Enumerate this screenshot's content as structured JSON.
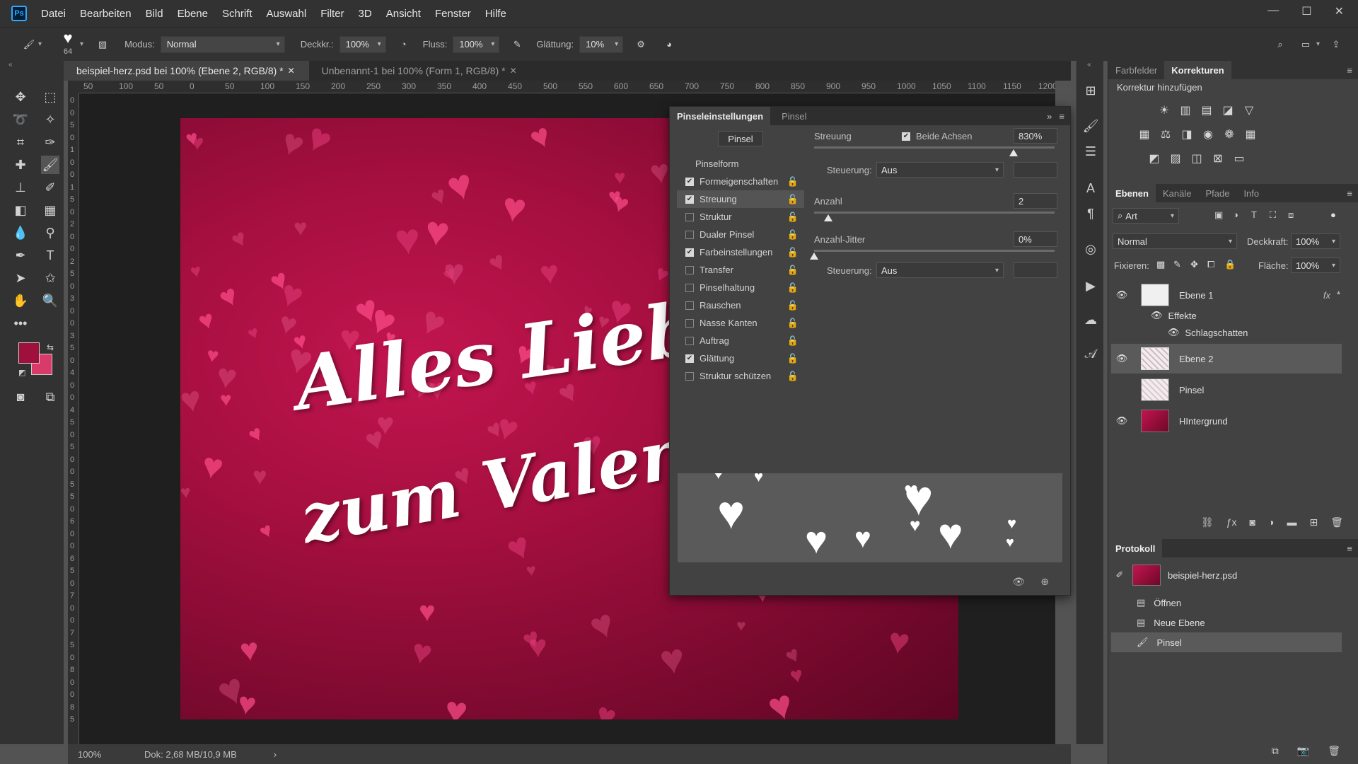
{
  "app": {
    "logo": "Ps"
  },
  "menu": [
    "Datei",
    "Bearbeiten",
    "Bild",
    "Ebene",
    "Schrift",
    "Auswahl",
    "Filter",
    "3D",
    "Ansicht",
    "Fenster",
    "Hilfe"
  ],
  "options": {
    "brush_size": "64",
    "modus_label": "Modus:",
    "modus_value": "Normal",
    "deckkraft_label": "Deckkr.:",
    "deckkraft_value": "100%",
    "fluss_label": "Fluss:",
    "fluss_value": "100%",
    "glaettung_label": "Glättung:",
    "glaettung_value": "10%"
  },
  "doc_tabs": [
    {
      "label": "beispiel-herz.psd bei 100% (Ebene 2, RGB/8) *",
      "active": true
    },
    {
      "label": "Unbenannt-1 bei 100% (Form 1, RGB/8) *",
      "active": false
    }
  ],
  "ruler_top": [
    "50",
    "100",
    "50",
    "0",
    "50",
    "100",
    "150",
    "200",
    "250",
    "300",
    "350",
    "400",
    "450",
    "500",
    "550",
    "600",
    "650",
    "700",
    "750",
    "800",
    "850",
    "900",
    "950",
    "1000",
    "1050",
    "1100",
    "1150",
    "1200"
  ],
  "ruler_left": [
    "0",
    "0",
    "5",
    "0",
    "1",
    "0",
    "0",
    "1",
    "5",
    "0",
    "2",
    "0",
    "0",
    "2",
    "5",
    "0",
    "3",
    "0",
    "0",
    "3",
    "5",
    "0",
    "4",
    "0",
    "0",
    "4",
    "5",
    "0",
    "5",
    "0",
    "0",
    "5",
    "5",
    "0",
    "6",
    "0",
    "0",
    "6",
    "5",
    "0",
    "7",
    "0",
    "0",
    "7",
    "5",
    "0",
    "8",
    "0",
    "0",
    "8",
    "5"
  ],
  "canvas_text": {
    "line1": "Alles Liebe",
    "line2": "zum Valentinstag"
  },
  "colors": {
    "foreground": "#a0103d",
    "background": "#d83a6a",
    "accent": "#31a8ff"
  },
  "status": {
    "zoom": "100%",
    "doc": "Dok: 2,68 MB/10,9 MB"
  },
  "brush_panel": {
    "tab_active": "Pinseleinstellungen",
    "tab_other": "Pinsel",
    "pinsel_button": "Pinsel",
    "pinselform": "Pinselform",
    "items": [
      {
        "label": "Formeigenschaften",
        "checked": true
      },
      {
        "label": "Streuung",
        "checked": true,
        "selected": true
      },
      {
        "label": "Struktur",
        "checked": false
      },
      {
        "label": "Dualer Pinsel",
        "checked": false
      },
      {
        "label": "Farbeinstellungen",
        "checked": true
      },
      {
        "label": "Transfer",
        "checked": false
      },
      {
        "label": "Pinselhaltung",
        "checked": false
      },
      {
        "label": "Rauschen",
        "checked": false
      },
      {
        "label": "Nasse Kanten",
        "checked": false
      },
      {
        "label": "Auftrag",
        "checked": false
      },
      {
        "label": "Glättung",
        "checked": true
      },
      {
        "label": "Struktur schützen",
        "checked": false
      }
    ],
    "streuung_label": "Streuung",
    "beide_achsen": "Beide Achsen",
    "streuung_value": "830%",
    "steuerung_label": "Steuerung:",
    "steuerung_value": "Aus",
    "anzahl_label": "Anzahl",
    "anzahl_value": "2",
    "anzahl_jitter_label": "Anzahl-Jitter",
    "anzahl_jitter_value": "0%",
    "steuerung2_label": "Steuerung:",
    "steuerung2_value": "Aus",
    "streuung_level": 0.83,
    "anzahl_level": 0.06,
    "jitter_level": 0.0
  },
  "right": {
    "top_tabs": [
      "Farbfelder",
      "Korrekturen"
    ],
    "korrektur_title": "Korrektur hinzufügen",
    "layer_tabs": [
      "Ebenen",
      "Kanäle",
      "Pfade",
      "Info"
    ],
    "filter_value": "Art",
    "blend_mode": "Normal",
    "deckkraft_label": "Deckkraft:",
    "deckkraft_value": "100%",
    "fixieren_label": "Fixieren:",
    "flaeche_label": "Fläche:",
    "flaeche_value": "100%",
    "layers": [
      {
        "name": "Ebene 1",
        "visible": true,
        "fx": "fx"
      },
      {
        "name": "Ebene 2",
        "visible": true,
        "selected": true
      },
      {
        "name": "Pinsel",
        "visible": false
      },
      {
        "name": "HIntergrund",
        "visible": true
      }
    ],
    "effekte_label": "Effekte",
    "schlagschatten_label": "Schlagschatten",
    "protokoll_title": "Protokoll",
    "history_snapshot": "beispiel-herz.psd",
    "history": [
      "Öffnen",
      "Neue Ebene",
      "Pinsel"
    ]
  }
}
